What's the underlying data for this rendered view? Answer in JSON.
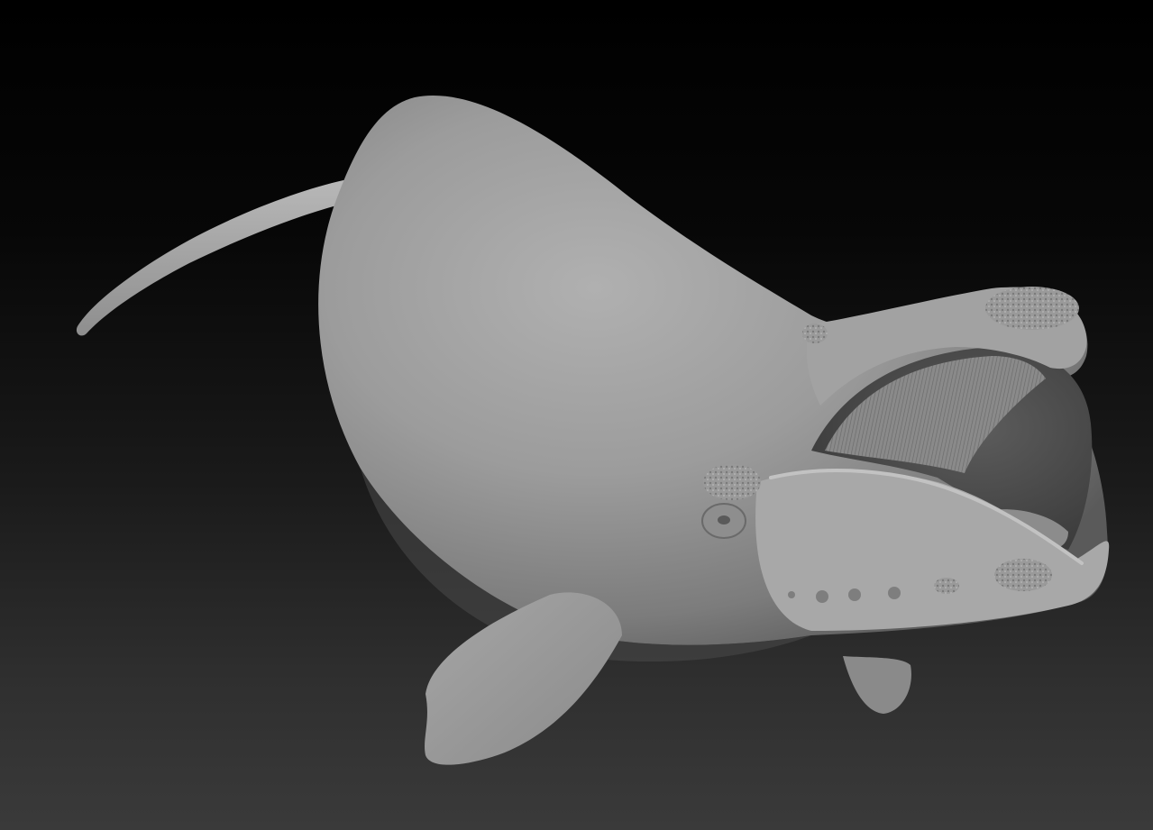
{
  "scene": {
    "subject": "whale-sculpt",
    "background_colors": [
      "#000000",
      "#1a1a1a",
      "#3a3a3a"
    ],
    "material_color": "#9a9a9a"
  }
}
